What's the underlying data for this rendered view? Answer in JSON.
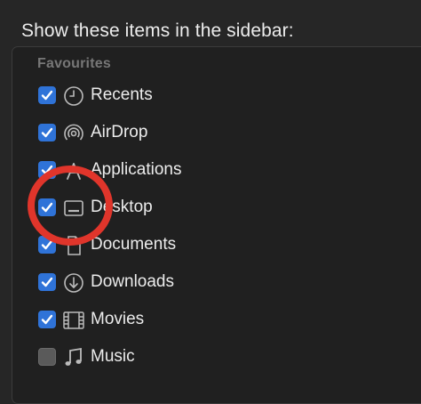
{
  "title": "Show these items in the sidebar:",
  "section": "Favourites",
  "items": [
    {
      "label": "Recents",
      "checked": true,
      "icon": "clock-icon"
    },
    {
      "label": "AirDrop",
      "checked": true,
      "icon": "airdrop-icon"
    },
    {
      "label": "Applications",
      "checked": true,
      "icon": "applications-icon"
    },
    {
      "label": "Desktop",
      "checked": true,
      "icon": "desktop-icon"
    },
    {
      "label": "Documents",
      "checked": true,
      "icon": "document-icon"
    },
    {
      "label": "Downloads",
      "checked": true,
      "icon": "download-icon"
    },
    {
      "label": "Movies",
      "checked": true,
      "icon": "film-icon"
    },
    {
      "label": "Music",
      "checked": false,
      "icon": "music-note-icon"
    }
  ],
  "colors": {
    "checkbox_on": "#2f73d8",
    "annotation_circle": "#e0352b"
  }
}
